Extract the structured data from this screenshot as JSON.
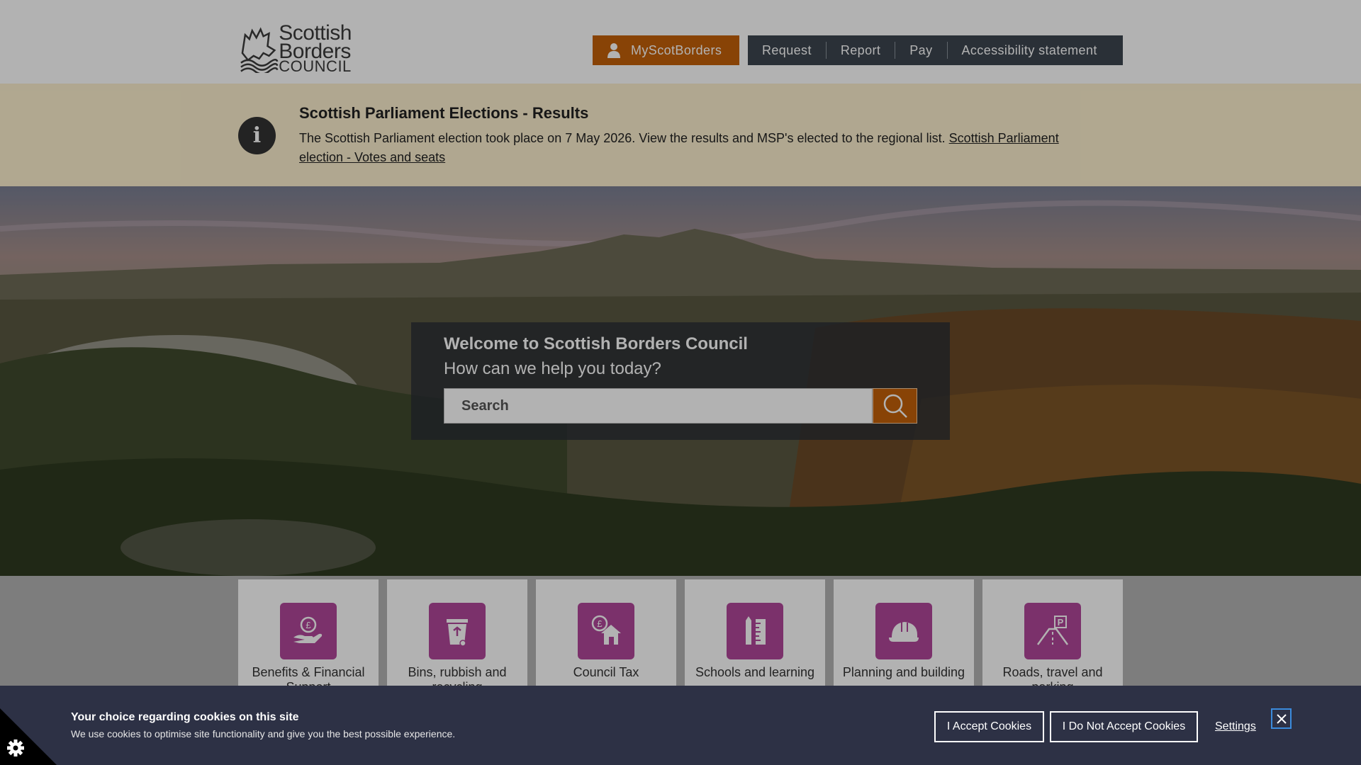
{
  "header": {
    "logo": {
      "line1": "Scottish",
      "line2": "Borders",
      "line3": "COUNCIL"
    },
    "my_account_label": "MyScotBorders",
    "nav": [
      "Request",
      "Report",
      "Pay",
      "Accessibility statement"
    ]
  },
  "alert": {
    "title": "Scottish Parliament Elections - Results",
    "body": "The Scottish Parliament election took place on 7 May 2026. View the results and MSP's elected to the regional list.",
    "link_text": "Scottish Parliament election - Votes and seats"
  },
  "hero": {
    "welcome": "Welcome to Scottish Borders Council",
    "help": "How can we help you today?",
    "search_placeholder": "Search"
  },
  "tiles": [
    {
      "label": "Benefits & Financial Support",
      "icon": "hand-pound-icon"
    },
    {
      "label": "Bins, rubbish and recycling",
      "icon": "bin-icon"
    },
    {
      "label": "Council Tax",
      "icon": "house-pound-icon"
    },
    {
      "label": "Schools and learning",
      "icon": "pencil-ruler-icon"
    },
    {
      "label": "Planning and building",
      "icon": "hard-hat-icon"
    },
    {
      "label": "Roads, travel and parking",
      "icon": "road-parking-icon"
    }
  ],
  "cookie": {
    "title": "Your choice regarding cookies on this site",
    "text": "We use cookies to optimise site functionality and give you the best possible experience.",
    "accept_label": "I Accept Cookies",
    "decline_label": "I Do Not Accept Cookies",
    "settings_label": "Settings"
  },
  "colors": {
    "accent_orange": "#c3610a",
    "nav_dark": "#3d4650",
    "alert_bg": "#fdf0cf",
    "tile_icon_purple": "#b0479a",
    "cookie_bg": "#2d3145"
  }
}
